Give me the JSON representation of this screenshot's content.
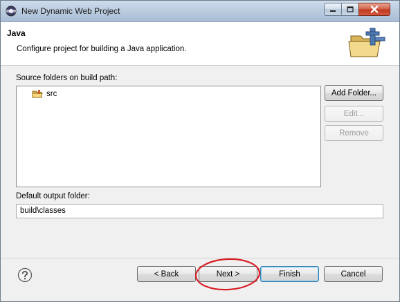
{
  "window": {
    "title": "New Dynamic Web Project"
  },
  "banner": {
    "title": "Java",
    "description": "Configure project for building a Java application."
  },
  "source_folders": {
    "label": "Source folders on build path:",
    "items": [
      {
        "label": "src",
        "icon": "source-folder-icon"
      }
    ],
    "buttons": {
      "add_folder": "Add Folder...",
      "edit": "Edit...",
      "remove": "Remove"
    }
  },
  "output_folder": {
    "label": "Default output folder:",
    "value": "build\\classes"
  },
  "footer": {
    "help_icon": "help-icon",
    "back": "< Back",
    "next": "Next >",
    "finish": "Finish",
    "cancel": "Cancel"
  },
  "colors": {
    "annotation_circle": "#d81f26",
    "close_button": "#c9462b"
  }
}
